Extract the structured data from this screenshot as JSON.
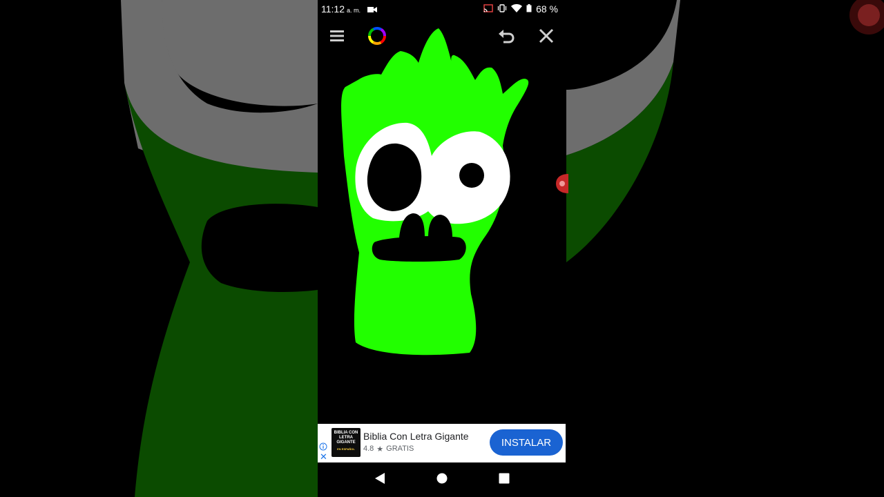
{
  "status_bar": {
    "time": "11:12",
    "ampm": "a. m.",
    "battery": "68 %",
    "icons": [
      "video-camera-icon",
      "cast-icon",
      "vibrate-icon",
      "wifi-icon",
      "battery-icon"
    ]
  },
  "toolbar": {
    "icons": [
      "menu-icon",
      "color-wheel-icon",
      "undo-icon",
      "close-icon"
    ]
  },
  "ad": {
    "logo_text": "BIBLIA CON LETRA GIGANTE",
    "logo_sub": "EN ESPAÑOL",
    "title": "Biblia Con Letra Gigante",
    "rating": "4.8",
    "star": "★",
    "price": "GRATIS",
    "install_label": "INSTALAR",
    "close_glyph": "✕"
  },
  "nav_bar": {
    "icons": [
      "back-icon",
      "home-icon",
      "recents-icon"
    ]
  },
  "colors": {
    "drawing_green": "#22ff00",
    "bg_green": "#0a4a00",
    "bg_gray": "#6e6e6e",
    "install_blue": "#1a63d2"
  }
}
